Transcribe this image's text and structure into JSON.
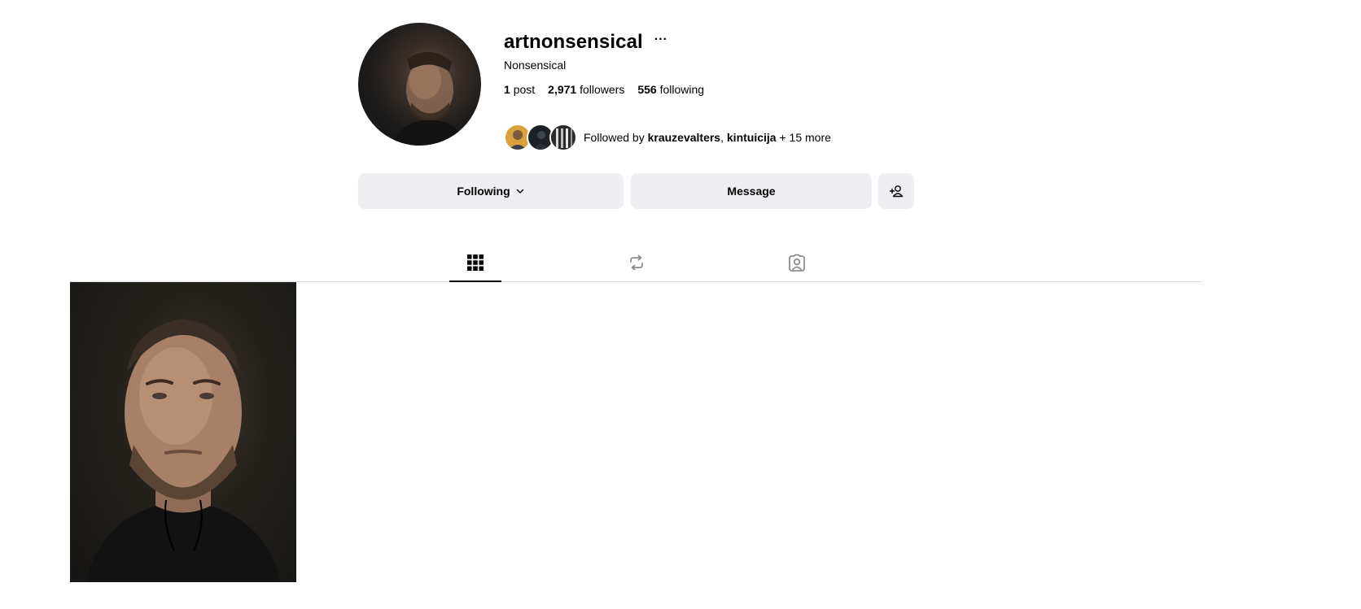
{
  "profile": {
    "username": "artnonsensical",
    "more_options_label": "···",
    "full_name": "Nonsensical",
    "stats": {
      "posts_count": "1",
      "posts_label": "post",
      "followers_count": "2,971",
      "followers_label": "followers",
      "following_count": "556",
      "following_label": "following"
    },
    "followed_by": {
      "prefix": "Followed by",
      "user_1": "krauzevalters",
      "separator": ",",
      "user_2": "kintuicija",
      "suffix": "+ 15 more"
    }
  },
  "actions": {
    "following_label": "Following",
    "message_label": "Message",
    "add_user_icon": "person-add-icon"
  },
  "tabs": [
    {
      "name": "posts",
      "icon": "grid-icon",
      "active": true
    },
    {
      "name": "reposts",
      "icon": "repost-icon",
      "active": false
    },
    {
      "name": "tagged",
      "icon": "tagged-person-icon",
      "active": false
    }
  ],
  "colors": {
    "button_bg": "#efeff3",
    "divider": "#dbdbdb",
    "text": "#000000",
    "background": "#ffffff"
  }
}
